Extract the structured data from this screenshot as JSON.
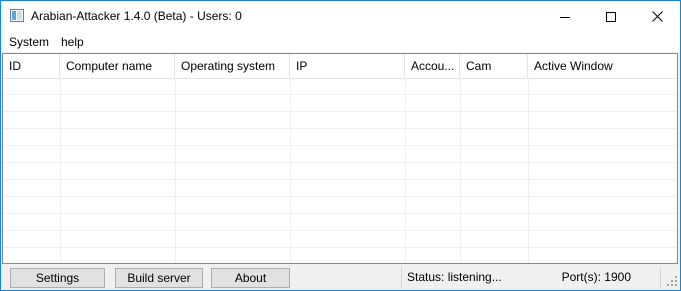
{
  "window": {
    "title": "Arabian-Attacker  1.4.0 (Beta) - Users: 0"
  },
  "menu": {
    "items": [
      {
        "label": "System"
      },
      {
        "label": "help"
      }
    ]
  },
  "table": {
    "columns": [
      {
        "label": "ID"
      },
      {
        "label": "Computer name"
      },
      {
        "label": "Operating system"
      },
      {
        "label": "IP"
      },
      {
        "label": "Accou..."
      },
      {
        "label": "Cam"
      },
      {
        "label": "Active Window"
      }
    ],
    "rows": []
  },
  "footer": {
    "buttons": [
      {
        "label": "Settings"
      },
      {
        "label": "Build server"
      },
      {
        "label": "About"
      }
    ],
    "status": "Status: listening...",
    "ports": "Port(s): 1900"
  },
  "icons": {
    "app": "app-window-icon",
    "minimize": "minimize-icon",
    "maximize": "maximize-icon",
    "close": "close-icon",
    "grip": "resize-grip-icon"
  },
  "colors": {
    "window_border": "#1883d7",
    "chrome": "#f0f0f0",
    "button_face": "#e1e1e1"
  }
}
